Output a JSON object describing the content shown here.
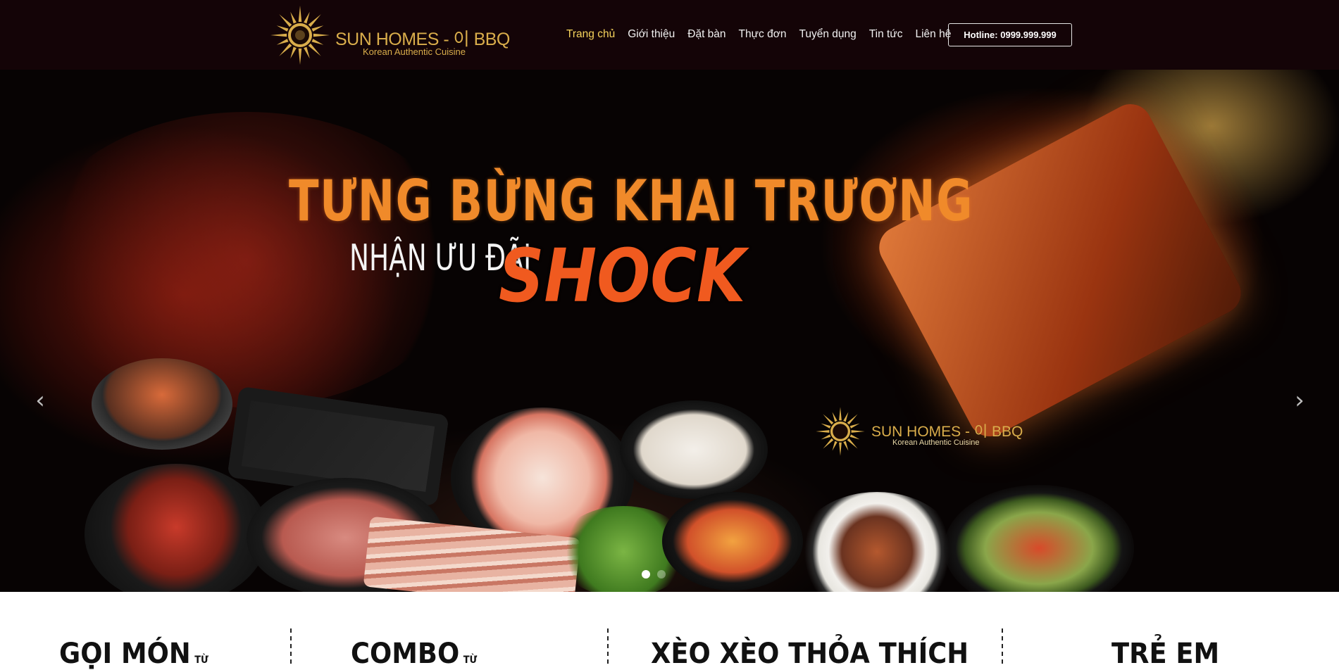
{
  "brand": {
    "name": "SUN HOMES - 이 BBQ",
    "tagline": "Korean Authentic Cuisine",
    "gold": "#d9ad4b"
  },
  "nav": {
    "items": [
      {
        "label": "Trang chủ",
        "active": true
      },
      {
        "label": "Giới thiệu"
      },
      {
        "label": "Đặt bàn"
      },
      {
        "label": "Thực đơn"
      },
      {
        "label": "Tuyển dụng"
      },
      {
        "label": "Tin tức"
      },
      {
        "label": "Liên hệ"
      }
    ],
    "hotline": "Hotline: 0999.999.999",
    "active_color": "#f6d35c"
  },
  "hero": {
    "line1": "TƯNG BỪNG KHAI TRƯƠNG",
    "line2": "NHẬN ƯU ĐÃI",
    "line3": "SHOCK",
    "logo_name": "SUN HOMES - 이 BBQ",
    "logo_tagline": "Korean Authentic Cuisine",
    "prev_icon": "chevron-left-icon",
    "next_icon": "chevron-right-icon",
    "slides": 2,
    "active_slide": 1
  },
  "features": [
    {
      "title": "GỌI MÓN",
      "suffix": "TỪ"
    },
    {
      "title": "COMBO",
      "suffix": "TỪ"
    },
    {
      "title": "XÈO XÈO THỎA THÍCH",
      "suffix": ""
    },
    {
      "title": "TRẺ EM",
      "suffix": ""
    }
  ]
}
